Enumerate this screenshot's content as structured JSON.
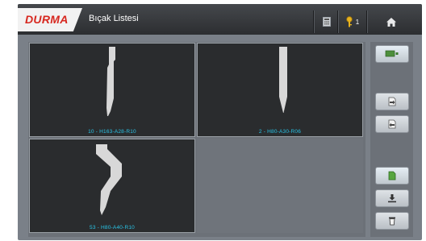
{
  "header": {
    "logo": "DURMA",
    "title": "Bıçak Listesi",
    "badge_count": "1"
  },
  "tools": [
    {
      "label": "10 - H163-A28-R10"
    },
    {
      "label": "2 - H80-A30-R06"
    },
    {
      "label": "53 - H80-A40-R10"
    }
  ],
  "colors": {
    "label_text": "#29c5e8",
    "logo_red": "#d7271f",
    "tile_bg": "#2a2c2e"
  },
  "side_buttons": [
    "view-toggle-icon",
    "export-doc-icon",
    "import-doc-icon",
    "new-file-icon",
    "download-icon",
    "trash-icon"
  ]
}
